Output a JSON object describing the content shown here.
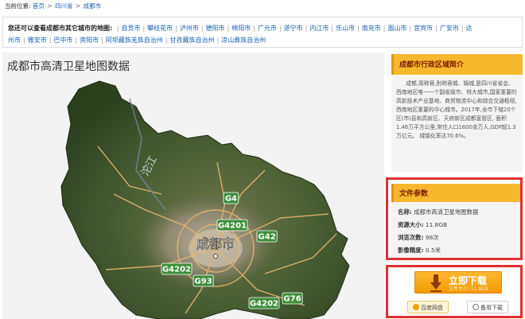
{
  "breadcrumb": {
    "prefix": "当前位置:",
    "items": [
      "首页",
      "四川省",
      "成都市"
    ],
    "separator": ">"
  },
  "cities": {
    "lead": "您还可以查看成都市其它城市的地图:",
    "line1": [
      "自贡市",
      "攀枝花市",
      "泸州市",
      "德阳市",
      "绵阳市",
      "广元市",
      "遂宁市",
      "内江市",
      "乐山市",
      "南充市",
      "眉山市",
      "宜宾市",
      "广安市",
      "达"
    ],
    "line2": [
      "州市",
      "雅安市",
      "巴中市",
      "资阳市",
      "阿坝藏族羌族自治州",
      "甘孜藏族自治州",
      "凉山彝族自治州"
    ]
  },
  "main": {
    "title": "成都市高清卫星地图数据"
  },
  "map": {
    "city_label": "成都市",
    "river_label": "沱江",
    "roads": [
      "G4201",
      "G42",
      "G4202",
      "G93",
      "G4202",
      "G76",
      "G4"
    ]
  },
  "sidebar": {
    "intro_title": "成都市行政区域简介",
    "intro_text": "成都,简称蓉,别称蓉城、锦城,是四川省省会、西南地区唯一一个副省级市、特大城市,国家重要的高新技术产业基地、商贸物流中心和综合交通枢纽,西南地区重要的中心城市。2017年,全市下辖20个区(市)县和高新区、天府新区成都直管区, 面积1.46万平方公里,常住人口1600余万人,GDP超1.3万亿元。 城镇化率达70.6%。"
  },
  "params": {
    "title": "文件参数",
    "name_label": "名称:",
    "name_value": "成都市高清卫星地图数据",
    "size_label": "资源大小:",
    "size_value": "11.8GB",
    "downloads_label": "浏览次数:",
    "downloads_value": "98次",
    "precision_label": "影像精度:",
    "precision_value": "0.5米"
  },
  "download": {
    "label": "立即下载",
    "sub": "文件大小: 11.8GB",
    "baidu_label": "百度网盘",
    "backup_label": "备用下载"
  },
  "colors": {
    "accent": "#f5b82e",
    "link": "#1a5fb4",
    "highlight": "#e03030"
  }
}
